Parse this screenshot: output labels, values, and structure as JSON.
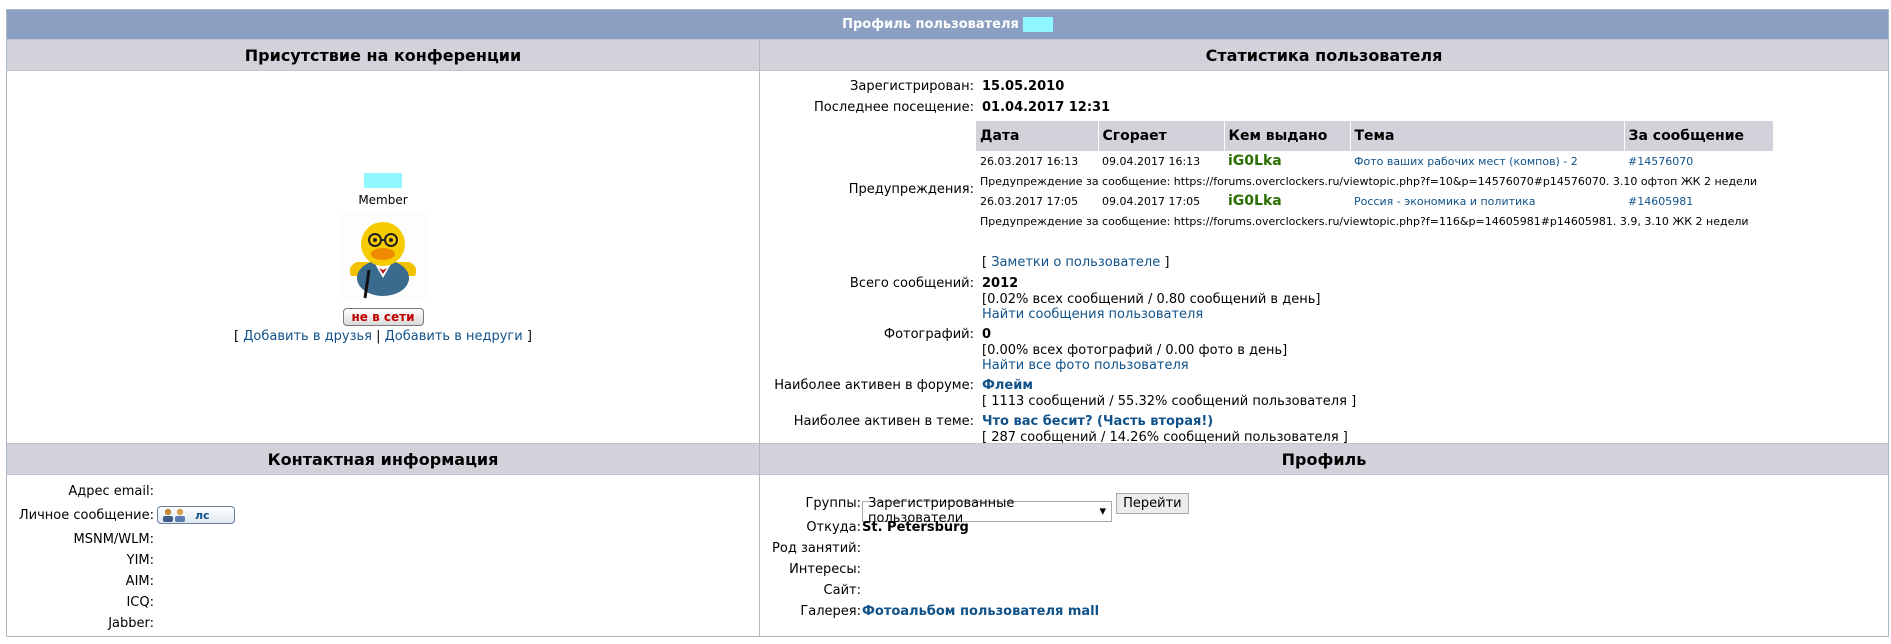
{
  "header": {
    "title": "Профиль пользователя"
  },
  "sections": {
    "presence": "Присутствие на конференции",
    "stats": "Статистика пользователя",
    "contact": "Контактная информация",
    "profile": "Профиль"
  },
  "presence": {
    "rank": "Member",
    "status_button": "не в сети",
    "bracket_open": "[",
    "add_friend": "Добавить в друзья",
    "separator": "|",
    "add_foe": "Добавить в недруги",
    "bracket_close": "]"
  },
  "stats": {
    "registered_label": "Зарегистрирован:",
    "registered_value": "15.05.2010",
    "last_visit_label": "Последнее посещение:",
    "last_visit_value": "01.04.2017 12:31",
    "warnings_label": "Предупреждения:",
    "warnings_table": {
      "headers": [
        "Дата",
        "Сгорает",
        "Кем выдано",
        "Тема",
        "За сообщение"
      ],
      "rows": [
        {
          "date": "26.03.2017 16:13",
          "expires": "09.04.2017 16:13",
          "issuer": "iG0Lka",
          "topic": "Фото ваших рабочих мест (компов) - 2",
          "post": "#14576070",
          "note": "Предупреждение за сообщение: https://forums.overclockers.ru/viewtopic.php?f=10&p=14576070#p14576070. 3.10 офтоп ЖК 2 недели"
        },
        {
          "date": "26.03.2017 17:05",
          "expires": "09.04.2017 17:05",
          "issuer": "iG0Lka",
          "topic": "Россия - экономика и политика",
          "post": "#14605981",
          "note": "Предупреждение за сообщение: https://forums.overclockers.ru/viewtopic.php?f=116&p=14605981#p14605981. 3.9, 3.10 ЖК 2 недели"
        }
      ]
    },
    "notes_bracket_open": "[",
    "notes_link": "Заметки о пользователе",
    "notes_bracket_close": "]",
    "posts_label": "Всего сообщений:",
    "posts_value": "2012",
    "posts_detail": "[0.02% всех сообщений / 0.80 сообщений в день]",
    "posts_link": "Найти сообщения пользователя",
    "photos_label": "Фотографий:",
    "photos_value": "0",
    "photos_detail": "[0.00% всех фотографий / 0.00 фото в день]",
    "photos_link": "Найти все фото пользователя",
    "active_forum_label": "Наиболее активен в форуме:",
    "active_forum_value": "Флейм",
    "active_forum_detail": "[ 1113 сообщений / 55.32% сообщений пользователя ]",
    "active_topic_label": "Наиболее активен в теме:",
    "active_topic_value": "Что вас бесит? (Часть вторая!)",
    "active_topic_detail": "[ 287 сообщений / 14.26% сообщений пользователя ]"
  },
  "contact": {
    "email_label": "Адрес email:",
    "pm_label": "Личное сообщение:",
    "pm_button": "лс",
    "msn_label": "MSNM/WLM:",
    "yim_label": "YIM:",
    "aim_label": "AIM:",
    "icq_label": "ICQ:",
    "jabber_label": "Jabber:"
  },
  "profile": {
    "groups_label": "Группы:",
    "groups_value": "Зарегистрированные пользователи",
    "go_button": "Перейти",
    "from_label": "Откуда:",
    "from_value": "St. Petersburg",
    "occupation_label": "Род занятий:",
    "interests_label": "Интересы:",
    "site_label": "Сайт:",
    "gallery_label": "Галерея:",
    "gallery_value": "Фотоальбом пользователя mall"
  },
  "colors": {
    "titlebar": "#8a9fc1",
    "cathead": "#d2d2db",
    "link": "#105289",
    "moderator": "#2b6e00",
    "offline": "#c00000",
    "masked": "#8ff7ff"
  }
}
